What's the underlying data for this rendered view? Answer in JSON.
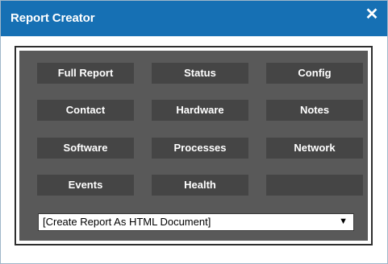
{
  "window": {
    "title": "Report Creator",
    "close_glyph": "✕"
  },
  "colors": {
    "titlebar": "#1670b4",
    "panel": "#595959",
    "button": "#454545"
  },
  "buttons": [
    {
      "label": "Full Report"
    },
    {
      "label": "Status"
    },
    {
      "label": "Config"
    },
    {
      "label": "Contact"
    },
    {
      "label": "Hardware"
    },
    {
      "label": "Notes"
    },
    {
      "label": "Software"
    },
    {
      "label": "Processes"
    },
    {
      "label": "Network"
    },
    {
      "label": "Events"
    },
    {
      "label": "Health"
    },
    {
      "label": ""
    }
  ],
  "format_select": {
    "value": "[Create Report As HTML Document]",
    "arrow_glyph": "▼"
  }
}
